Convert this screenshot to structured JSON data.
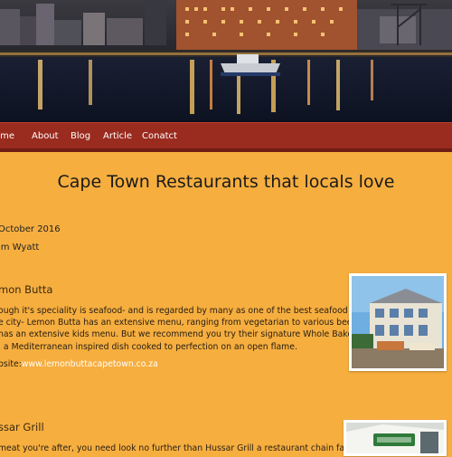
{
  "nav": {
    "items": [
      "ome",
      "About",
      "Blog",
      "Article",
      "Conatct"
    ]
  },
  "article": {
    "title": "Cape Town Restaurants that locals love",
    "date": "October 2016",
    "author": "im Wyatt",
    "sections": [
      {
        "heading": "mon Butta",
        "lines": [
          "ough it's speciality is seafood- and is regarded by many as one of the best seafood restaurants",
          "e city- Lemon Butta has an extensive menu, ranging from vegetarian to various beef cuts. It",
          "has an extensive kids menu. But we recommend you try their signature Whole Baked Line",
          ", a Mediterranean inspired dish cooked to perfection on an open flame."
        ],
        "website_label": "bsite:",
        "website_url": "www.lemonbuttacapetown.co.za"
      },
      {
        "heading": "ssar Grill",
        "lines": [
          "meat you're after, you need look no further than Hussar Grill a restaurant chain famed for"
        ]
      }
    ]
  },
  "colors": {
    "background": "#f6ae3f",
    "navbar": "#9a2b1f",
    "link": "#ffffff"
  }
}
